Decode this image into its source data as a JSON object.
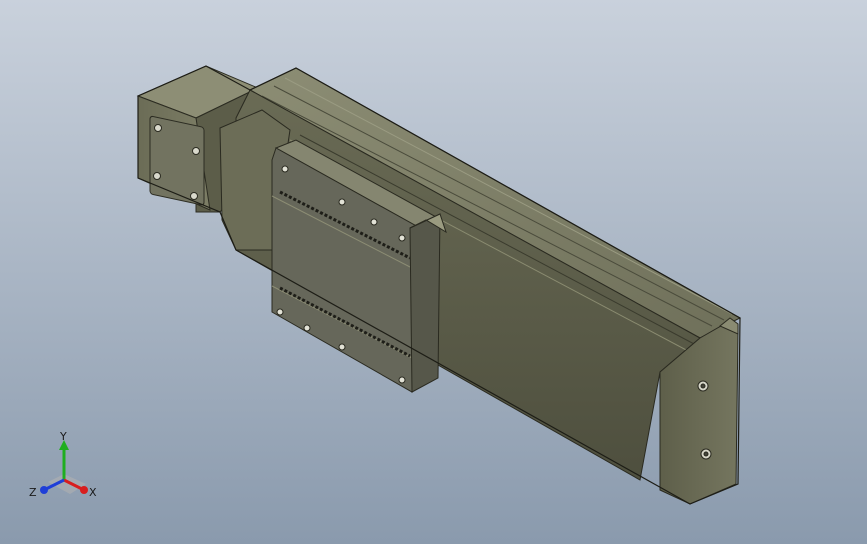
{
  "viewport": {
    "background_top": "#c9d1dc",
    "background_bottom": "#8a9aad"
  },
  "model": {
    "body_color": "#63634e",
    "highlight_color": "#8a8b72",
    "shadow_color": "#3d3d30"
  },
  "triad": {
    "x_label": "X",
    "y_label": "Y",
    "z_label": "Z",
    "x_color": "#d81e1e",
    "y_color": "#1fae1f",
    "z_color": "#1f3fd8"
  }
}
